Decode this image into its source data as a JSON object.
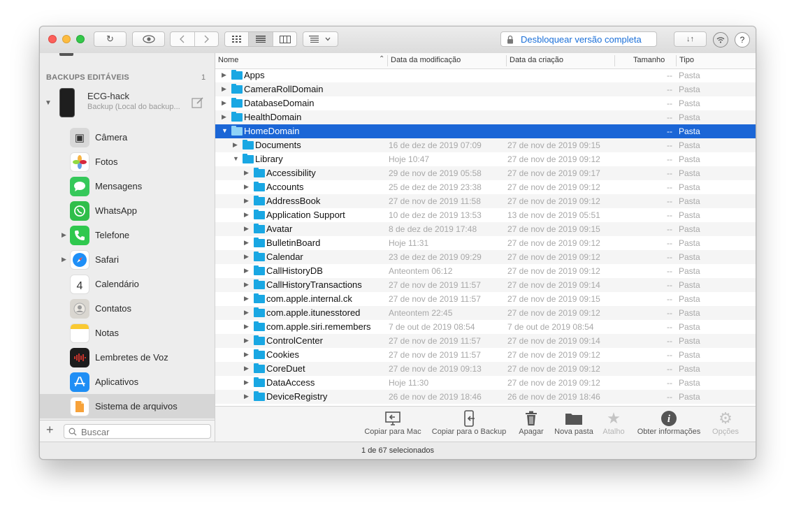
{
  "toolbar": {
    "unlock_label": "Desbloquear versão completa",
    "help_label": "?"
  },
  "sidebar": {
    "section_title": "BACKUPS EDITÁVEIS",
    "section_count": "1",
    "device": {
      "name": "ECG-hack",
      "subtitle": "Backup (Local do backup..."
    },
    "items": [
      {
        "label": "Câmera",
        "icon": "camera-icon"
      },
      {
        "label": "Fotos",
        "icon": "photos-icon"
      },
      {
        "label": "Mensagens",
        "icon": "messages-icon"
      },
      {
        "label": "WhatsApp",
        "icon": "whatsapp-icon"
      },
      {
        "label": "Telefone",
        "icon": "phone-icon"
      },
      {
        "label": "Safari",
        "icon": "safari-icon"
      },
      {
        "label": "Calendário",
        "icon": "calendar-icon",
        "glyph": "4"
      },
      {
        "label": "Contatos",
        "icon": "contacts-icon"
      },
      {
        "label": "Notas",
        "icon": "notes-icon"
      },
      {
        "label": "Lembretes de Voz",
        "icon": "voice-memos-icon"
      },
      {
        "label": "Aplicativos",
        "icon": "app-store-icon"
      },
      {
        "label": "Sistema de arquivos",
        "icon": "files-icon"
      }
    ],
    "search_placeholder": "Buscar",
    "add_label": "+"
  },
  "columns": {
    "name": "Nome",
    "modified": "Data da modificação",
    "created": "Data da criação",
    "size": "Tamanho",
    "type": "Tipo"
  },
  "rows": [
    {
      "name": "Apps",
      "modified": "",
      "created": "",
      "size": "--",
      "type": "Pasta"
    },
    {
      "name": "CameraRollDomain",
      "modified": "",
      "created": "",
      "size": "--",
      "type": "Pasta"
    },
    {
      "name": "DatabaseDomain",
      "modified": "",
      "created": "",
      "size": "--",
      "type": "Pasta"
    },
    {
      "name": "HealthDomain",
      "modified": "",
      "created": "",
      "size": "--",
      "type": "Pasta"
    },
    {
      "name": "HomeDomain",
      "modified": "",
      "created": "",
      "size": "--",
      "type": "Pasta"
    },
    {
      "name": "Documents",
      "modified": "16 de dez de 2019 07:09",
      "created": "27 de nov de 2019 09:15",
      "size": "--",
      "type": "Pasta"
    },
    {
      "name": "Library",
      "modified": "Hoje 10:47",
      "created": "27 de nov de 2019 09:12",
      "size": "--",
      "type": "Pasta"
    },
    {
      "name": "Accessibility",
      "modified": "29 de nov de 2019 05:58",
      "created": "27 de nov de 2019 09:17",
      "size": "--",
      "type": "Pasta"
    },
    {
      "name": "Accounts",
      "modified": "25 de dez de 2019 23:38",
      "created": "27 de nov de 2019 09:12",
      "size": "--",
      "type": "Pasta"
    },
    {
      "name": "AddressBook",
      "modified": "27 de nov de 2019 11:58",
      "created": "27 de nov de 2019 09:12",
      "size": "--",
      "type": "Pasta"
    },
    {
      "name": "Application Support",
      "modified": "10 de dez de 2019 13:53",
      "created": "13 de nov de 2019 05:51",
      "size": "--",
      "type": "Pasta"
    },
    {
      "name": "Avatar",
      "modified": "8 de dez de 2019 17:48",
      "created": "27 de nov de 2019 09:15",
      "size": "--",
      "type": "Pasta"
    },
    {
      "name": "BulletinBoard",
      "modified": "Hoje 11:31",
      "created": "27 de nov de 2019 09:12",
      "size": "--",
      "type": "Pasta"
    },
    {
      "name": "Calendar",
      "modified": "23 de dez de 2019 09:29",
      "created": "27 de nov de 2019 09:12",
      "size": "--",
      "type": "Pasta"
    },
    {
      "name": "CallHistoryDB",
      "modified": "Anteontem 06:12",
      "created": "27 de nov de 2019 09:12",
      "size": "--",
      "type": "Pasta"
    },
    {
      "name": "CallHistoryTransactions",
      "modified": "27 de nov de 2019 11:57",
      "created": "27 de nov de 2019 09:14",
      "size": "--",
      "type": "Pasta"
    },
    {
      "name": "com.apple.internal.ck",
      "modified": "27 de nov de 2019 11:57",
      "created": "27 de nov de 2019 09:15",
      "size": "--",
      "type": "Pasta"
    },
    {
      "name": "com.apple.itunesstored",
      "modified": "Anteontem 22:45",
      "created": "27 de nov de 2019 09:12",
      "size": "--",
      "type": "Pasta"
    },
    {
      "name": "com.apple.siri.remembers",
      "modified": "7 de out de 2019 08:54",
      "created": "7 de out de 2019 08:54",
      "size": "--",
      "type": "Pasta"
    },
    {
      "name": "ControlCenter",
      "modified": "27 de nov de 2019 11:57",
      "created": "27 de nov de 2019 09:14",
      "size": "--",
      "type": "Pasta"
    },
    {
      "name": "Cookies",
      "modified": "27 de nov de 2019 11:57",
      "created": "27 de nov de 2019 09:12",
      "size": "--",
      "type": "Pasta"
    },
    {
      "name": "CoreDuet",
      "modified": "27 de nov de 2019 09:13",
      "created": "27 de nov de 2019 09:12",
      "size": "--",
      "type": "Pasta"
    },
    {
      "name": "DataAccess",
      "modified": "Hoje 11:30",
      "created": "27 de nov de 2019 09:12",
      "size": "--",
      "type": "Pasta"
    },
    {
      "name": "DeviceRegistry",
      "modified": "26 de nov de 2019 18:46",
      "created": "26 de nov de 2019 18:46",
      "size": "--",
      "type": "Pasta"
    }
  ],
  "actions": [
    {
      "label": "Copiar para Mac",
      "icon": "copy-to-mac-icon",
      "enabled": true
    },
    {
      "label": "Copiar para o Backup",
      "icon": "copy-to-backup-icon",
      "enabled": true
    },
    {
      "label": "Apagar",
      "icon": "trash-icon",
      "enabled": true
    },
    {
      "label": "Nova pasta",
      "icon": "new-folder-icon",
      "enabled": true
    },
    {
      "label": "Atalho",
      "icon": "star-icon",
      "enabled": false
    },
    {
      "label": "Obter informações",
      "icon": "info-icon",
      "enabled": true
    },
    {
      "label": "Opções",
      "icon": "gear-icon",
      "enabled": false
    }
  ],
  "status": "1 de 67 selecionados",
  "colors": {
    "selection": "#1b66d6",
    "folder": "#19a7e3",
    "link": "#1a6fd8"
  }
}
